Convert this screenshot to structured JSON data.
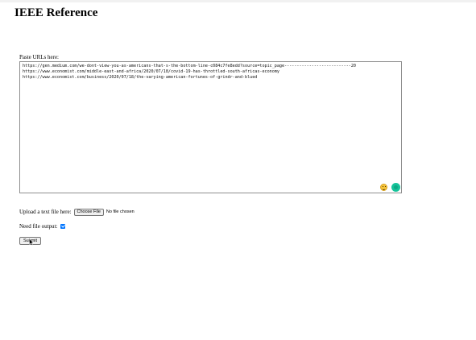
{
  "page": {
    "title": "IEEE Reference"
  },
  "urls": {
    "label": "Paste URLs here:",
    "lines": [
      "https://gen.medium.com/we-dont-view-you-as-americans-that-s-the-bottom-line-c084c7fe8edd?source=topic_page---------------------------20",
      "https://www.economist.com/middle-east-and-africa/2020/07/18/covid-19-has-throttled-south-africas-economy",
      "https://www.economist.com/business/2020/07/18/the-varying-american-fortunes-of-grindr-and-blued"
    ],
    "emoji_icon": "smiley-emoji-icon",
    "grammarly_icon": "grammarly-icon"
  },
  "upload": {
    "label": "Upload a text file here:",
    "button_label": "Choose File",
    "status": "No file chosen"
  },
  "file_output": {
    "label": "Need file output:",
    "checked": true,
    "checkbox_color": "#0075ff"
  },
  "submit": {
    "label": "Submit"
  }
}
